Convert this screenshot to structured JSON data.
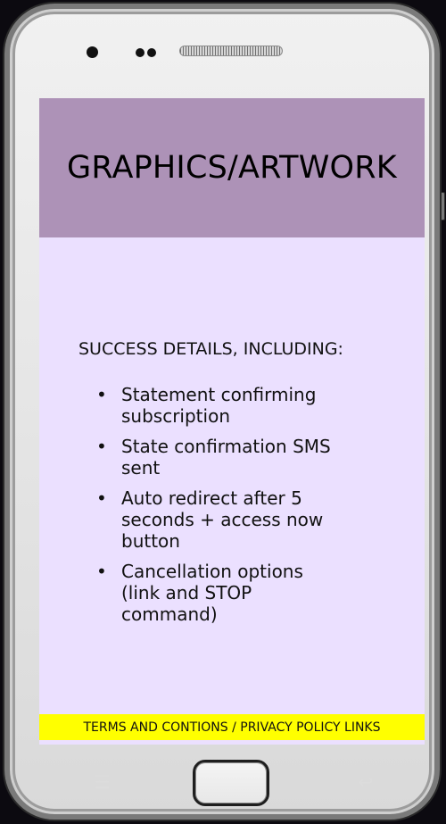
{
  "screen": {
    "hero_title": "GRAPHICS/ARTWORK",
    "details_heading": "SUCCESS DETAILS, INCLUDING:",
    "details_items": [
      "Statement confirming subscription",
      "State confirmation SMS sent",
      "Auto redirect after 5 seconds + access now button",
      "Cancellation options (link and STOP command)"
    ],
    "footer_text": "TERMS AND CONTIONS / PRIVACY POLICY LINKS"
  },
  "phone": {
    "colors": {
      "background": "#0c0a10",
      "body": "#e6e6e6",
      "screen": "#ebe0ff",
      "hero": "#ad92b7",
      "footer": "#ffff00"
    },
    "icons": {
      "front_camera": "front-camera-icon",
      "sensor": "sensor-icon",
      "speaker": "speaker-grill-icon",
      "menu": "menu-icon",
      "back": "back-icon",
      "home": "home-button"
    }
  }
}
